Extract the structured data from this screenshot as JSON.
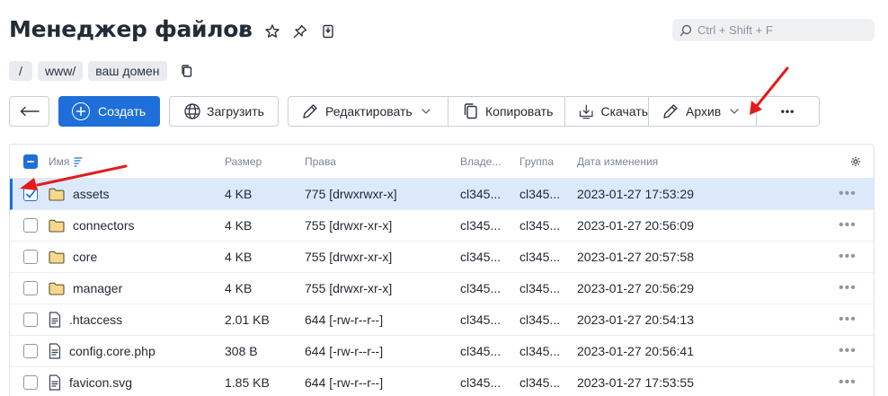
{
  "header": {
    "title": "Менеджер файлов",
    "icons": [
      "link-icon",
      "star-icon",
      "pin-icon",
      "bookmark-file-icon"
    ]
  },
  "search": {
    "placeholder": "Ctrl + Shift + F"
  },
  "breadcrumb": {
    "items": [
      "/",
      "www/",
      "ваш домен"
    ]
  },
  "toolbar": {
    "back_icon": "arrow-left-icon",
    "create": "Создать",
    "upload": "Загрузить",
    "edit": "Редактировать",
    "copy": "Копировать",
    "download": "Скачать",
    "archive": "Архив",
    "more": "•••"
  },
  "table": {
    "columns": {
      "name": "Имя",
      "size": "Размер",
      "perm": "Права",
      "owner": "Владе...",
      "group": "Группа",
      "date": "Дата изменения"
    },
    "rows": [
      {
        "type": "folder",
        "name": "assets",
        "size": "4 KB",
        "perm": "775 [drwxrwxr-x]",
        "owner": "cl345...",
        "group": "cl345...",
        "date": "2023-01-27 17:53:29",
        "selected": true
      },
      {
        "type": "folder",
        "name": "connectors",
        "size": "4 KB",
        "perm": "755 [drwxr-xr-x]",
        "owner": "cl345...",
        "group": "cl345...",
        "date": "2023-01-27 20:56:09",
        "selected": false
      },
      {
        "type": "folder",
        "name": "core",
        "size": "4 KB",
        "perm": "755 [drwxr-xr-x]",
        "owner": "cl345...",
        "group": "cl345...",
        "date": "2023-01-27 20:57:58",
        "selected": false
      },
      {
        "type": "folder",
        "name": "manager",
        "size": "4 KB",
        "perm": "755 [drwxr-xr-x]",
        "owner": "cl345...",
        "group": "cl345...",
        "date": "2023-01-27 20:56:29",
        "selected": false
      },
      {
        "type": "file",
        "name": ".htaccess",
        "size": "2.01 KB",
        "perm": "644 [-rw-r--r--]",
        "owner": "cl345...",
        "group": "cl345...",
        "date": "2023-01-27 20:54:13",
        "selected": false
      },
      {
        "type": "file",
        "name": "config.core.php",
        "size": "308 B",
        "perm": "644 [-rw-r--r--]",
        "owner": "cl345...",
        "group": "cl345...",
        "date": "2023-01-27 20:56:41",
        "selected": false
      },
      {
        "type": "file",
        "name": "favicon.svg",
        "size": "1.85 KB",
        "perm": "644 [-rw-r--r--]",
        "owner": "cl345...",
        "group": "cl345...",
        "date": "2023-01-27 17:53:55",
        "selected": false
      }
    ],
    "row_menu": "•••"
  },
  "colors": {
    "accent": "#1e6fd9",
    "selected_row": "#dce9fb",
    "folder": "#f5d88a",
    "annotation_arrow": "#e31b1b"
  }
}
